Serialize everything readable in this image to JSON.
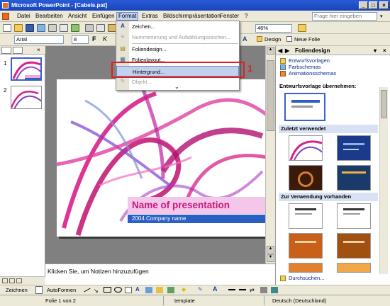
{
  "window": {
    "title": "Microsoft PowerPoint - [Cabels.pat]"
  },
  "menubar": {
    "items": [
      "Datei",
      "Bearbeiten",
      "Ansicht",
      "Einfügen",
      "Format",
      "Extras",
      "Bildschirmpräsentation",
      "Fenster",
      "?"
    ],
    "help_placeholder": "Frage hier eingeben"
  },
  "toolbar": {
    "font_name": "Arial",
    "font_size": "8",
    "zoom": "46%",
    "design_label": "Design",
    "new_slide_label": "Neue Folie"
  },
  "format_menu": {
    "items": [
      {
        "label": "Zeichen...",
        "icon": "A",
        "enabled": true,
        "highlighted": false
      },
      {
        "label": "Nummerierung und Aufzählungszeichen...",
        "icon": "≡",
        "enabled": false,
        "highlighted": false
      },
      {
        "label": "Foliendesign...",
        "icon": "▤",
        "enabled": true,
        "highlighted": false
      },
      {
        "label": "Folienlayout...",
        "icon": "▦",
        "enabled": true,
        "highlighted": false
      },
      {
        "label": "Hintergrund...",
        "icon": "",
        "enabled": true,
        "highlighted": true
      },
      {
        "label": "Objekt...",
        "icon": "✎",
        "enabled": false,
        "highlighted": false
      }
    ],
    "more_icon": "double-chevron-down-icon"
  },
  "annotation": {
    "number": "1",
    "color": "#e02020"
  },
  "slides_pane": {
    "thumb_numbers": [
      "1",
      "2"
    ]
  },
  "slide": {
    "title": "Name of presentation",
    "subtitle": "2004 Company name"
  },
  "notes": {
    "placeholder": "Klicken Sie, um Notizen hinzuzufügen"
  },
  "task_pane": {
    "title": "Foliendesign",
    "links": [
      "Entwurfsvorlagen",
      "Farbschemas",
      "Animationsschemas"
    ],
    "apply_label": "Entwurfsvorlage übernehmen:",
    "section_recent": "Zuletzt verwendet",
    "section_available": "Zur Verwendung vorhanden",
    "browse_link": "Durchsuchen..."
  },
  "drawing_toolbar": {
    "draw_label": "Zeichnen",
    "autoshapes_label": "AutoFormen"
  },
  "statusbar": {
    "slide_info": "Folie 1 von 2",
    "template": "template",
    "language": "Deutsch (Deutschland)"
  },
  "colors": {
    "brand_pink": "#c8187a",
    "accent_blue": "#2a5fc4",
    "title_bar": "#2a5bd7"
  }
}
